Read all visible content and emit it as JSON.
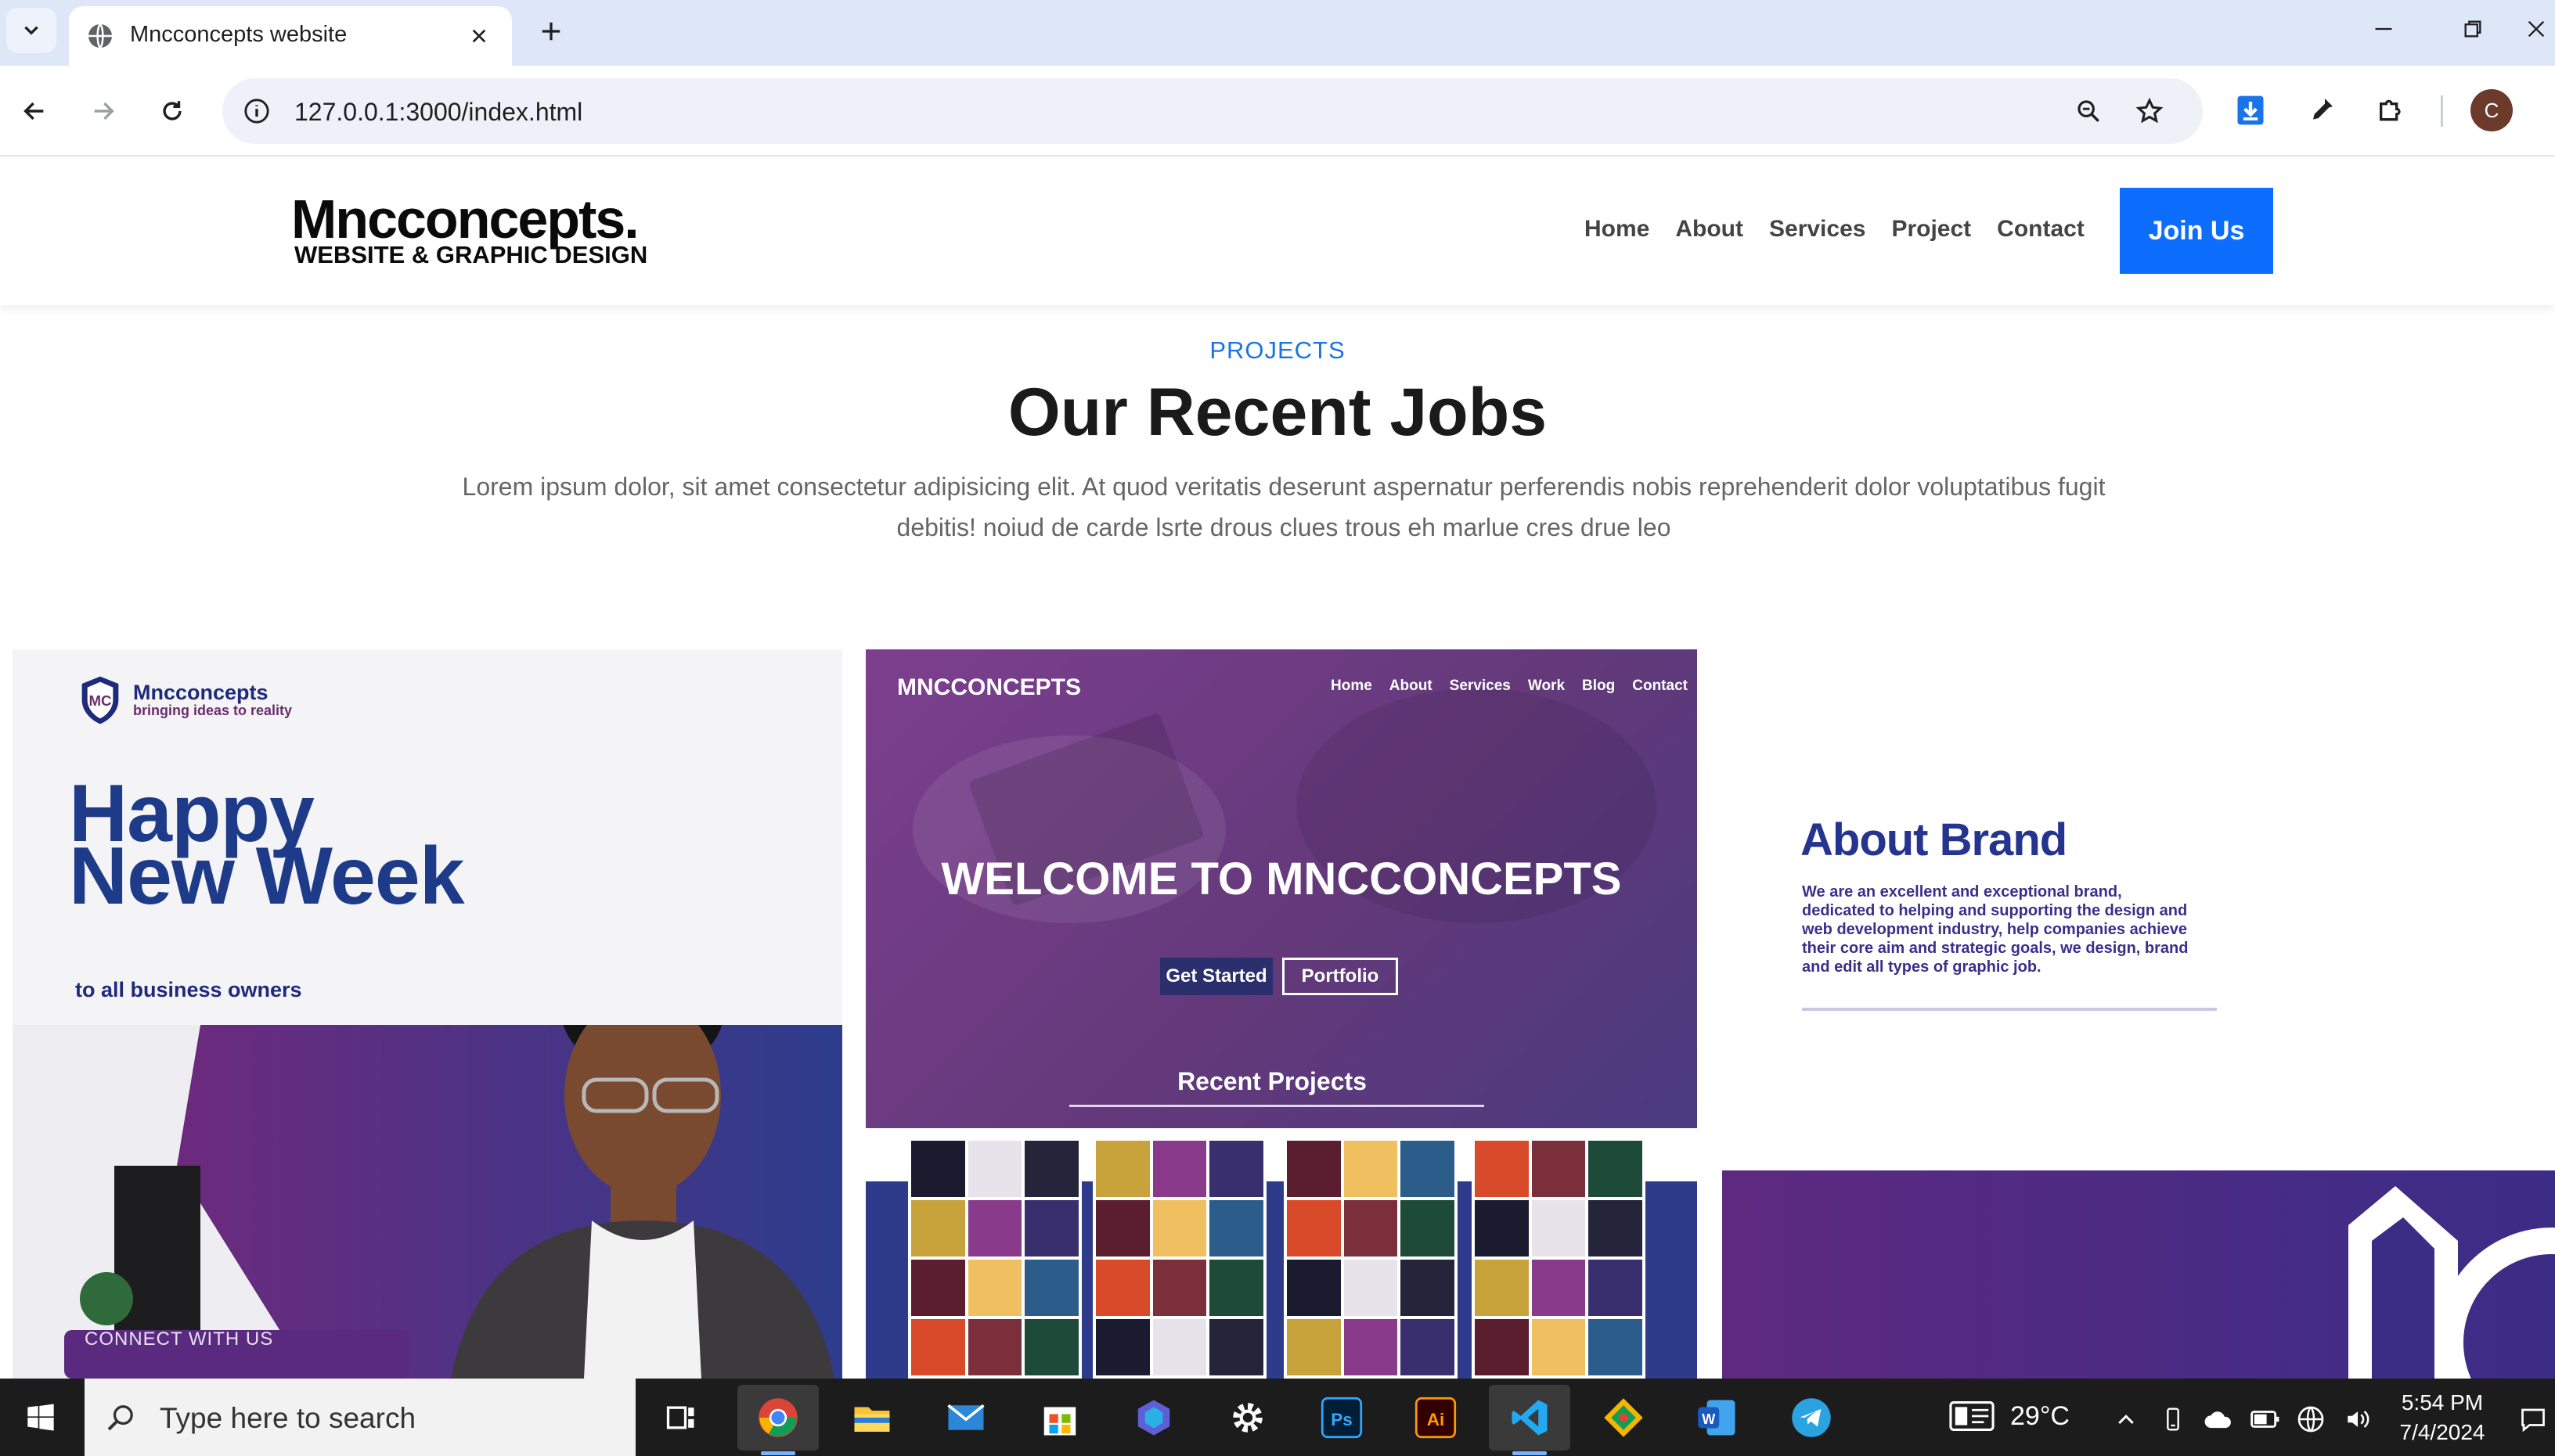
{
  "browser": {
    "tab": {
      "title": "Mncconcepts website"
    },
    "url": "127.0.0.1:3000/index.html",
    "profile_initial": "C",
    "icons": {
      "tab_list": "chevron-down-icon",
      "favicon": "globe-icon",
      "close": "close-icon",
      "new_tab": "plus-icon",
      "back": "back-arrow-icon",
      "forward": "forward-arrow-icon",
      "reload": "reload-icon",
      "site_info": "info-icon",
      "zoom": "zoom-icon",
      "bookmark": "star-icon",
      "download": "download-icon",
      "eyedropper": "eyedropper-icon",
      "extensions": "puzzle-icon",
      "minimize": "minimize-icon",
      "restore": "restore-icon",
      "window_close": "close-icon"
    }
  },
  "site": {
    "logo": {
      "main": "Mncconcepts.",
      "sub": "WEBSITE & GRAPHIC DESIGN"
    },
    "nav": [
      "Home",
      "About",
      "Services",
      "Project",
      "Contact"
    ],
    "cta": "Join Us",
    "accent": "#0d6efd",
    "section": {
      "eyebrow": "PROJECTS",
      "title": "Our Recent Jobs",
      "description": "Lorem ipsum dolor, sit amet consectetur adipisicing elit. At quod veritatis deserunt aspernatur perferendis nobis reprehenderit dolor voluptatibus fugit debitis! noiud de carde lsrte drous clues trous eh marlue cres drue leo"
    },
    "projects": [
      {
        "brand": "Mncconcepts",
        "tagline": "bringing ideas to reality",
        "headline": "Happy New Week",
        "subline": "to all business owners",
        "footer": "CONNECT WITH US"
      },
      {
        "brand": "MNCCONCEPTS",
        "menu": [
          "Home",
          "About",
          "Services",
          "Work",
          "Blog",
          "Contact"
        ],
        "welcome": "WELCOME TO MNCCONCEPTS",
        "buttons": [
          "Get Started",
          "Portfolio"
        ],
        "recent": "Recent Projects"
      },
      {
        "title": "About Brand",
        "body": "We are an excellent and exceptional brand, dedicated to helping and supporting the design and web development industry, help companies achieve their core aim and strategic goals, we design, brand and edit all types of graphic job."
      }
    ]
  },
  "taskbar": {
    "search_placeholder": "Type here to search",
    "apps": [
      "task-view",
      "chrome",
      "file-explorer",
      "mail",
      "microsoft-store",
      "copilot",
      "settings",
      "photoshop",
      "illustrator",
      "vs-code",
      "git-kraken",
      "word",
      "telegram"
    ],
    "app_labels": {
      "photoshop": "Ps",
      "illustrator": "Ai",
      "word": "W"
    },
    "weather": "29°C",
    "time": "5:54 PM",
    "date": "7/4/2024"
  }
}
